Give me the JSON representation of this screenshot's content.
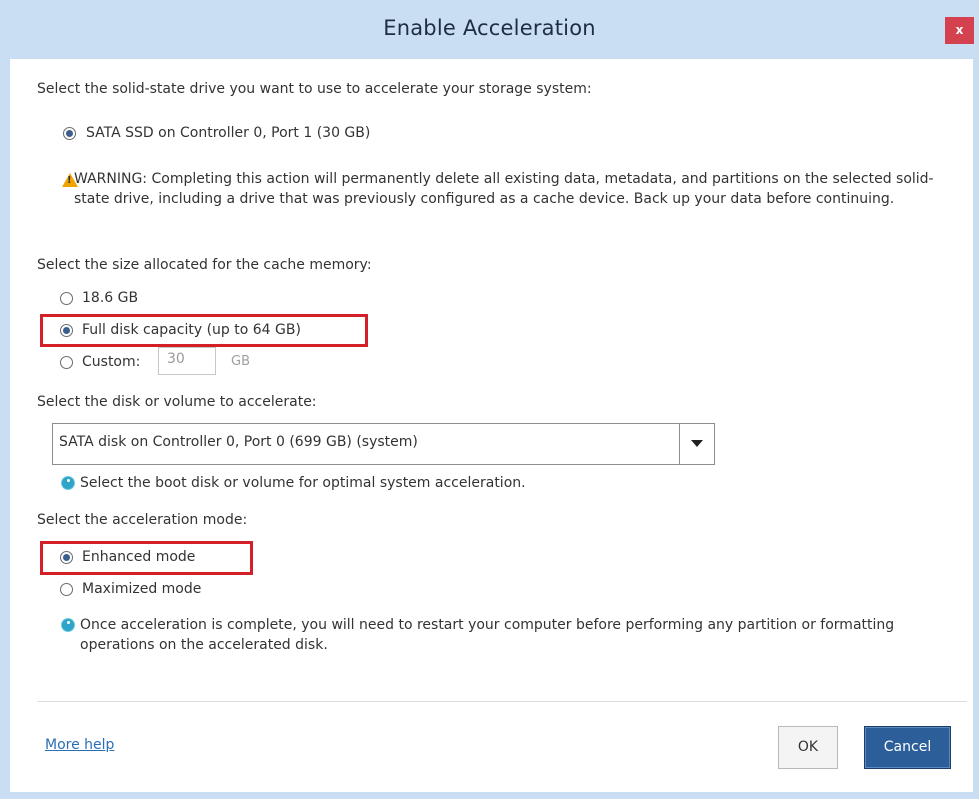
{
  "window": {
    "title": "Enable Acceleration",
    "close_label": "x"
  },
  "ssd_section": {
    "prompt": "Select the solid-state drive you want to use to accelerate your storage system:",
    "option": "SATA SSD on Controller 0, Port 1 (30 GB)",
    "warning": "WARNING: Completing this action will permanently delete all existing data, metadata, and partitions on the selected solid-state drive, including a drive that was previously configured as a cache device. Back up your data before continuing."
  },
  "cache_section": {
    "prompt": "Select the size allocated for the cache memory:",
    "options": [
      {
        "label": "18.6 GB",
        "selected": false
      },
      {
        "label": "Full disk capacity (up to 64 GB)",
        "selected": true
      },
      {
        "label": "Custom:",
        "selected": false
      }
    ],
    "custom_value": "30",
    "custom_unit": "GB"
  },
  "disk_section": {
    "prompt": "Select the disk or volume to accelerate:",
    "selected_value": "SATA disk on Controller 0, Port 0 (699 GB) (system)",
    "hint": "Select the boot disk or volume for optimal system acceleration."
  },
  "mode_section": {
    "prompt": "Select the acceleration mode:",
    "options": [
      {
        "label": "Enhanced mode",
        "selected": true
      },
      {
        "label": "Maximized mode",
        "selected": false
      }
    ],
    "note": "Once acceleration is complete, you will need to restart your computer before performing any partition or formatting operations on the accelerated disk."
  },
  "footer": {
    "more_help": "More help",
    "ok_label": "OK",
    "cancel_label": "Cancel"
  },
  "colors": {
    "title_bar": "#c9def2",
    "highlight": "#d21f28",
    "cancel_bg": "#2c5f99",
    "close_bg": "#d5424f"
  }
}
